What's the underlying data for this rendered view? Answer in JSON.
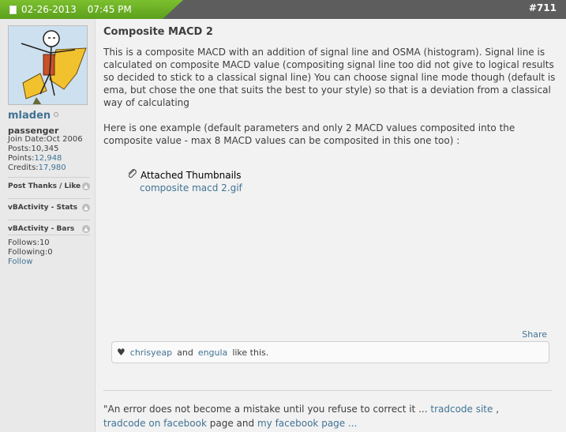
{
  "header": {
    "date": "02-26-2013",
    "time": "07:45 PM",
    "post_number": "#711"
  },
  "user": {
    "name": "mladen",
    "title": "passenger",
    "join_date": "Join Date:Oct 2006",
    "posts_label": "Posts:",
    "posts_value": "10,345",
    "points_label": "Points:",
    "points_value": "12,948",
    "credits_label": "Credits:",
    "credits_value": "17,980",
    "sections": [
      "Post Thanks / Like",
      "vBActivity - Stats",
      "vBActivity - Bars"
    ],
    "follows": "Follows:10",
    "following": "Following:0",
    "follow_link": "Follow"
  },
  "post": {
    "title": "Composite MACD 2",
    "paragraph1": "This is a composite MACD with an addition of signal line and OSMA (histogram). Signal line is calculated on composite MACD value (compositing signal line too did not give to logical results so decided to stick to a classical signal line) You can choose signal line mode though (default is ema, but chose the one that suits the best to your style) so that is a deviation from a classical way of calculating",
    "paragraph2": "Here is one example (default parameters and only 2 MACD values composited into the composite value - max 8 MACD values can be composited in this one too) :",
    "attachments_label": "Attached Thumbnails",
    "attachment_file": "composite macd 2.gif",
    "share_label": "Share",
    "likes": {
      "user1": "chrisyeap",
      "and": "and",
      "user2": "engula",
      "suffix": "like this."
    }
  },
  "signature": {
    "quote": "\"An error does not become a mistake until you refuse to correct it ...",
    "link1": "tradcode site",
    "comma": ",",
    "link2": "tradcode on facebook",
    "middle": "page and",
    "link3": "my facebook page ..."
  },
  "colors": {
    "accent_green": "#6bb024",
    "link": "#417394",
    "header_dark": "#5d5d5d"
  }
}
